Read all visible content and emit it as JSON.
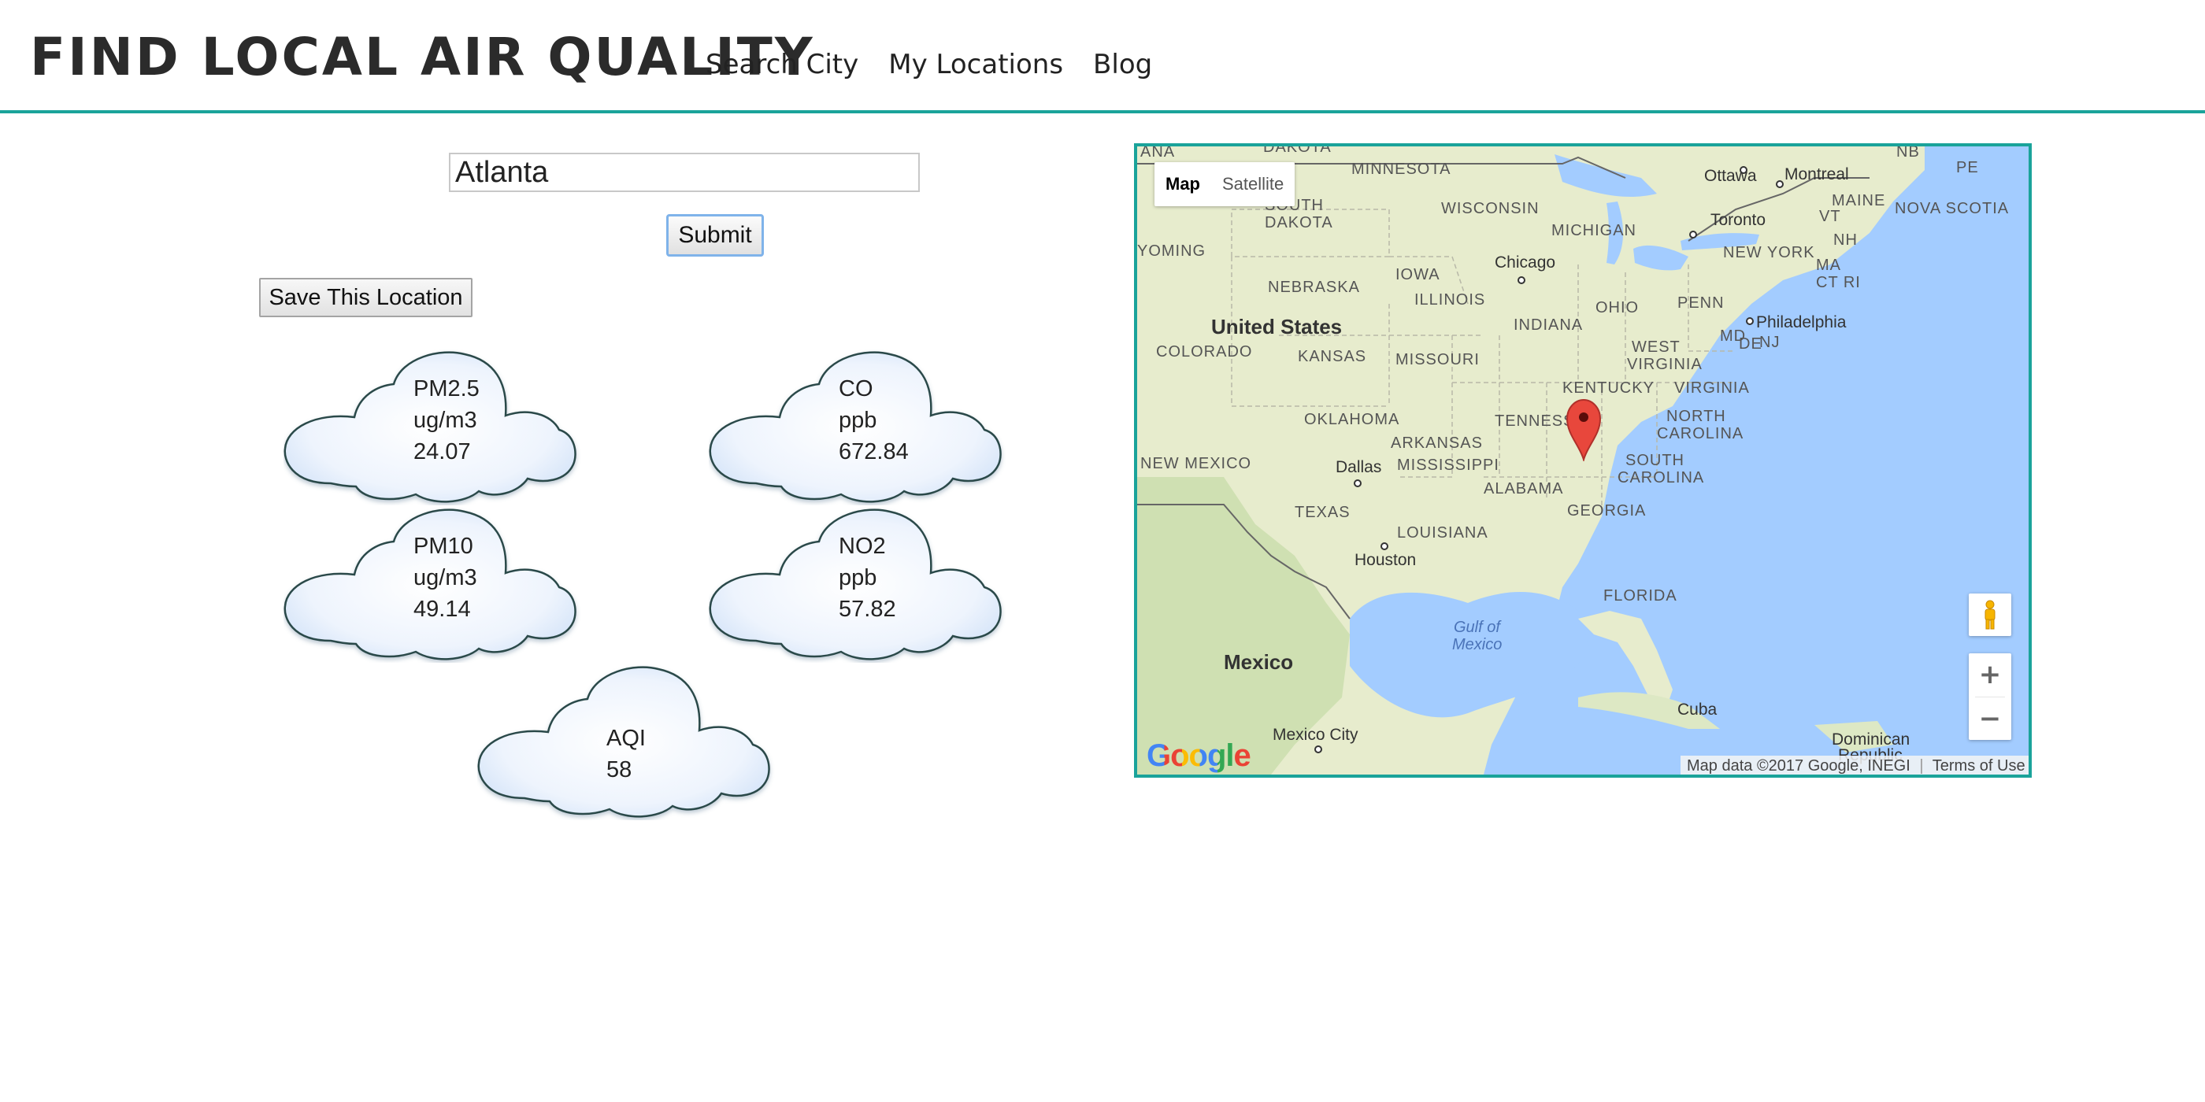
{
  "header": {
    "title": "FIND LOCAL AIR QUALITY",
    "nav": [
      "Search City",
      "My Locations",
      "Blog"
    ]
  },
  "search": {
    "city_value": "Atlanta",
    "submit_label": "Submit"
  },
  "save_label": "Save This Location",
  "pollutants": [
    {
      "name": "PM2.5",
      "unit": "ug/m3",
      "value": "24.07"
    },
    {
      "name": "CO",
      "unit": "ppb",
      "value": "672.84"
    },
    {
      "name": "PM10",
      "unit": "ug/m3",
      "value": "49.14"
    },
    {
      "name": "NO2",
      "unit": "ppb",
      "value": "57.82"
    }
  ],
  "aqi": {
    "label": "AQI",
    "value": "58"
  },
  "map": {
    "type_buttons": [
      "Map",
      "Satellite"
    ],
    "zoom_in": "+",
    "zoom_out": "−",
    "logo": "Google",
    "attribution": "Map data ©2017 Google, INEGI",
    "terms": "Terms of Use",
    "labels": {
      "ana": "ANA",
      "dakota": "DAKOTA",
      "minnesota": "MINNESOTA",
      "ottawa": "Ottawa",
      "montreal": "Montreal",
      "nb": "NB",
      "pe": "PE",
      "south": "SOUTH",
      "dakota2": "DAKOTA",
      "wisconsin": "WISCONSIN",
      "michigan": "MICHIGAN",
      "toronto": "Toronto",
      "maine": "MAINE",
      "nova_scotia": "NOVA SCOTIA",
      "vt": "VT",
      "nh": "NH",
      "yoming": "YOMING",
      "iowa": "IOWA",
      "chicago": "Chicago",
      "new_york": "NEW YORK",
      "ma": "MA",
      "ctri": "CT RI",
      "nebraska": "NEBRASKA",
      "illinois": "ILLINOIS",
      "ohio": "OHIO",
      "penn": "PENN",
      "united_states": "United States",
      "indiana": "INDIANA",
      "md": "MD",
      "philadelphia": "Philadelphia",
      "de": "DE",
      "nj": "NJ",
      "colorado": "COLORADO",
      "kansas": "KANSAS",
      "missouri": "MISSOURI",
      "west": "WEST",
      "virginia1": "VIRGINIA",
      "kentucky": "KENTUCKY",
      "virginia2": "VIRGINIA",
      "oklahoma": "OKLAHOMA",
      "tennessee": "TENNESSEE",
      "north": "NORTH",
      "carolina1": "CAROLINA",
      "arkansas": "ARKANSAS",
      "new_mexico": "NEW MEXICO",
      "dallas": "Dallas",
      "mississippi": "MISSISSIPPI",
      "south2": "SOUTH",
      "carolina2": "CAROLINA",
      "alabama": "ALABAMA",
      "georgia": "GEORGIA",
      "texas": "TEXAS",
      "louisiana": "LOUISIANA",
      "houston": "Houston",
      "florida": "FLORIDA",
      "gulf1": "Gulf of",
      "gulf2": "Mexico",
      "mexico": "Mexico",
      "cuba": "Cuba",
      "mexico_city": "Mexico City",
      "dominican1": "Dominican",
      "dominican2": "Republic"
    }
  }
}
